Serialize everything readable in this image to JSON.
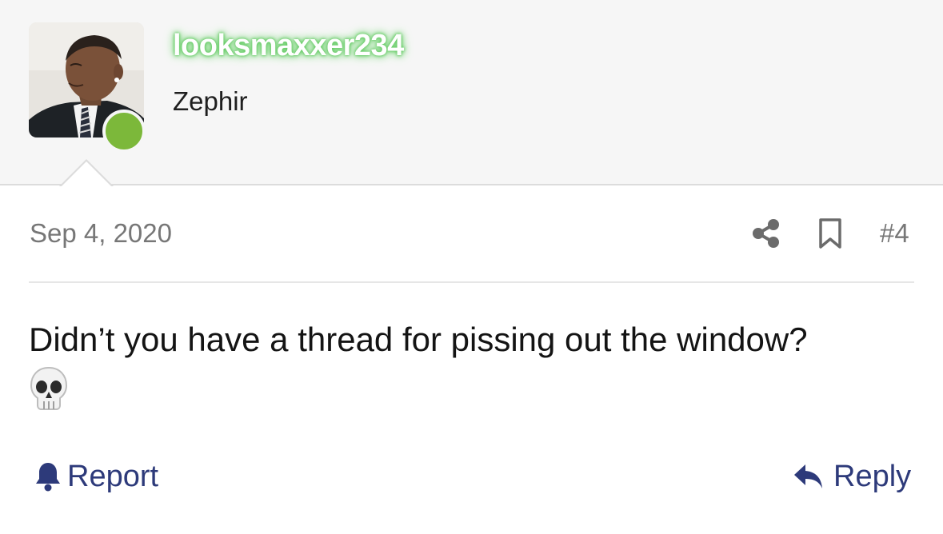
{
  "post": {
    "author": {
      "username": "looksmaxxer234",
      "title": "Zephir",
      "online": true,
      "username_color": "#ffffff",
      "username_glow_color": "#5fc95f",
      "online_indicator_color": "#7cb83a"
    },
    "date": "Sep 4, 2020",
    "post_number": "#4",
    "message": {
      "text": "Didn’t you have a thread for pissing out the window?",
      "emoji": "skull"
    },
    "actions": {
      "share_icon": "share-icon",
      "bookmark_icon": "bookmark-icon",
      "report_label": "Report",
      "report_icon": "bell-icon",
      "reply_label": "Reply",
      "reply_icon": "reply-arrow-icon"
    }
  },
  "colors": {
    "header_background": "#f6f6f6",
    "link": "#2d3a7a",
    "muted_text": "#777777",
    "divider": "#e6e6e6"
  }
}
